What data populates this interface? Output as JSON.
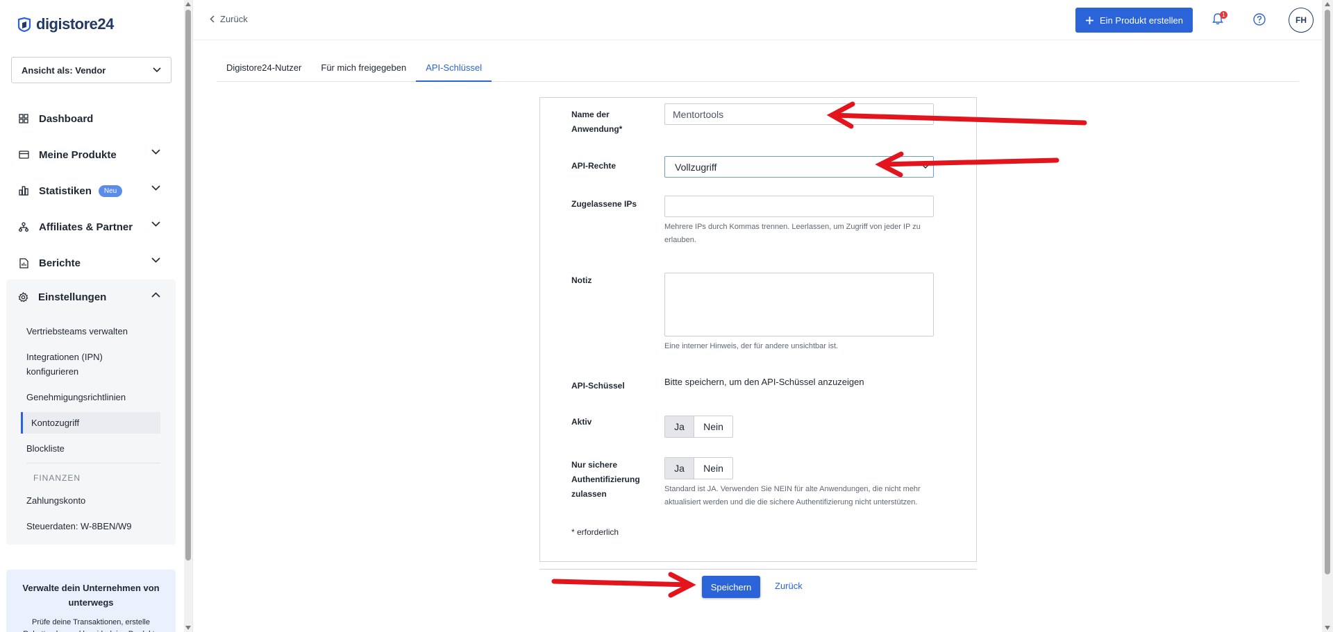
{
  "brand": {
    "name": "digistore24"
  },
  "sidebar": {
    "view_as": "Ansicht als: Vendor",
    "items": [
      {
        "label": "Dashboard",
        "icon": "grid-icon"
      },
      {
        "label": "Meine Produkte",
        "icon": "card-icon"
      },
      {
        "label": "Statistiken",
        "icon": "chart-icon",
        "badge": "Neu"
      },
      {
        "label": "Affiliates & Partner",
        "icon": "network-icon"
      },
      {
        "label": "Berichte",
        "icon": "report-icon"
      }
    ],
    "settings": {
      "label": "Einstellungen",
      "sub_items": [
        "Vertriebsteams verwalten",
        "Integrationen (IPN) konfigurieren",
        "Genehmigungsrichtlinien",
        "Kontozugriff",
        "Blockliste"
      ],
      "finance_label": "FINANZEN",
      "finance_items": [
        "Zahlungskonto",
        "Steuerdaten: W-8BEN/W9"
      ]
    },
    "promo": {
      "title": "Verwalte dein Unternehmen von unterwegs",
      "text": "Prüfe deine Transaktionen, erstelle Rabattcodes und bewirb deine Produkte"
    }
  },
  "topbar": {
    "back": "Zurück",
    "create_button": "Ein Produkt erstellen",
    "notification_count": "1",
    "avatar": "FH"
  },
  "tabs": [
    "Digistore24-Nutzer",
    "Für mich freigegeben",
    "API-Schlüssel"
  ],
  "form": {
    "name_label": "Name der Anwendung*",
    "name_value": "Mentortools",
    "rights_label": "API-Rechte",
    "rights_value": "Vollzugriff",
    "ips_label": "Zugelassene IPs",
    "ips_value": "",
    "ips_help": "Mehrere IPs durch Kommas trennen. Leerlassen, um Zugriff von jeder IP zu erlauben.",
    "note_label": "Notiz",
    "note_help": "Eine interner Hinweis, der für andere unsichtbar ist.",
    "key_label": "API-Schüssel",
    "key_value": "Bitte speichern, um den API-Schüssel anzuzeigen",
    "active_label": "Aktiv",
    "secure_label": "Nur sichere Authentifizierung zulassen",
    "yes": "Ja",
    "no": "Nein",
    "secure_help": "Standard ist JA. Verwenden Sie NEIN für alte Anwendungen, die nicht mehr aktualisiert werden und die die sichere Authentifizierung nicht unterstützen.",
    "required_note": "* erforderlich",
    "save": "Speichern",
    "back": "Zurück"
  },
  "colors": {
    "primary": "#2b63d9",
    "annotation": "#e3141c",
    "brand_dark": "#243a64"
  }
}
